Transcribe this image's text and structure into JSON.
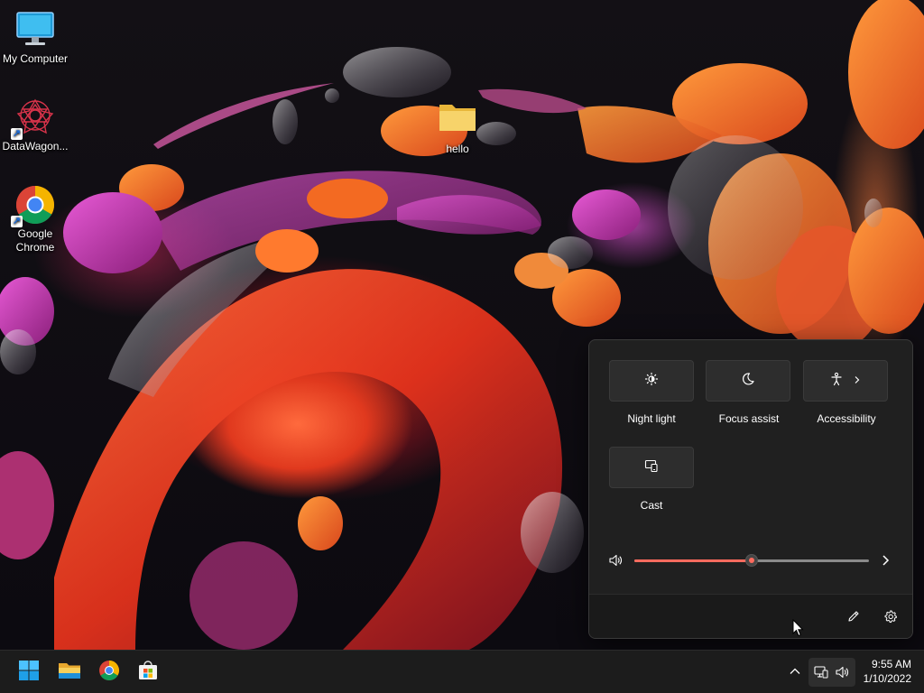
{
  "desktop": {
    "icons": [
      {
        "label": "My Computer"
      },
      {
        "label": "DataWagon..."
      },
      {
        "label": "Google\nChrome"
      },
      {
        "label": "hello"
      }
    ]
  },
  "quick_settings": {
    "tiles": [
      {
        "label": "Night light",
        "icon": "brightness-icon"
      },
      {
        "label": "Focus assist",
        "icon": "moon-icon"
      },
      {
        "label": "Accessibility",
        "icon": "accessibility-icon"
      },
      {
        "label": "Cast",
        "icon": "cast-icon"
      }
    ],
    "volume": {
      "level": 0.5,
      "icon": "speaker-icon"
    },
    "accent_color": "#ff6b5e",
    "footer": {
      "edit_icon": "pencil-icon",
      "settings_icon": "gear-icon"
    }
  },
  "taskbar": {
    "pinned": [
      {
        "name": "Start",
        "icon": "windows-logo-icon"
      },
      {
        "name": "File Explorer",
        "icon": "folder-icon"
      },
      {
        "name": "Google Chrome",
        "icon": "chrome-icon"
      },
      {
        "name": "Microsoft Store",
        "icon": "store-icon"
      }
    ],
    "tray": {
      "network_icon": "network-icon",
      "volume_icon": "speaker-icon"
    },
    "clock": {
      "time": "9:55 AM",
      "date": "1/10/2022"
    }
  }
}
